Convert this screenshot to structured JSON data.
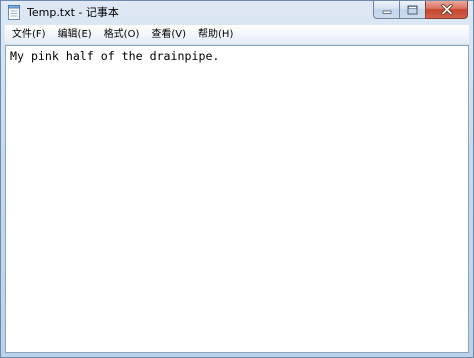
{
  "window": {
    "title": "Temp.txt - 记事本"
  },
  "caption_buttons": {
    "minimize_icon": "minimize-icon",
    "maximize_icon": "maximize-icon",
    "close_icon": "close-icon"
  },
  "menu": {
    "items": [
      {
        "label": "文件(F)"
      },
      {
        "label": "编辑(E)"
      },
      {
        "label": "格式(O)"
      },
      {
        "label": "查看(V)"
      },
      {
        "label": "帮助(H)"
      }
    ]
  },
  "document": {
    "content": "My pink half of the drainpipe."
  }
}
